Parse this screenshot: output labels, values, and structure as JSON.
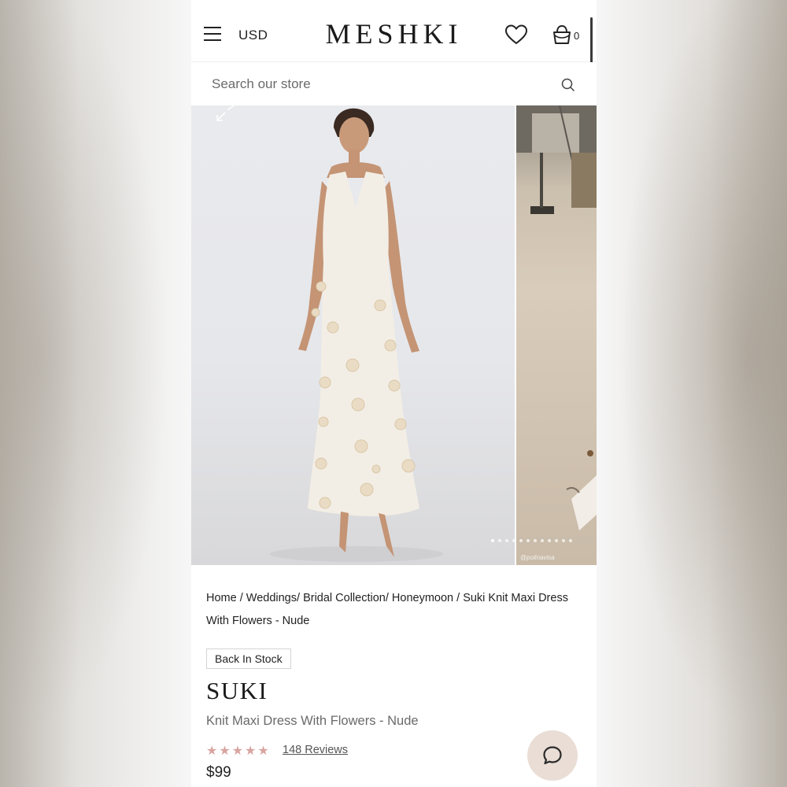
{
  "header": {
    "currency": "USD",
    "logo": "MESHKI",
    "bag_count": "0"
  },
  "search": {
    "placeholder": "Search our store"
  },
  "gallery": {
    "watermark": "@polinavisa",
    "slide_count": 12,
    "active_slide": 1
  },
  "breadcrumb": {
    "items": [
      "Home",
      "Weddings",
      "Bridal Collection",
      "Honeymoon",
      "Suki Knit Maxi Dress With Flowers - Nude"
    ],
    "seps": [
      "/",
      "/",
      "/",
      "/"
    ]
  },
  "product": {
    "badge": "Back In Stock",
    "name": "SUKI",
    "subtitle": "Knit Maxi Dress With Flowers - Nude",
    "stars": "★★★★★",
    "reviews": "148 Reviews",
    "price": "$99"
  },
  "colors": {
    "star": "#d9a4a0",
    "chat_bg": "#e9ddd5"
  },
  "icons": [
    "hamburger-icon",
    "heart-icon",
    "bag-icon",
    "search-icon",
    "expand-icon",
    "chat-icon"
  ]
}
